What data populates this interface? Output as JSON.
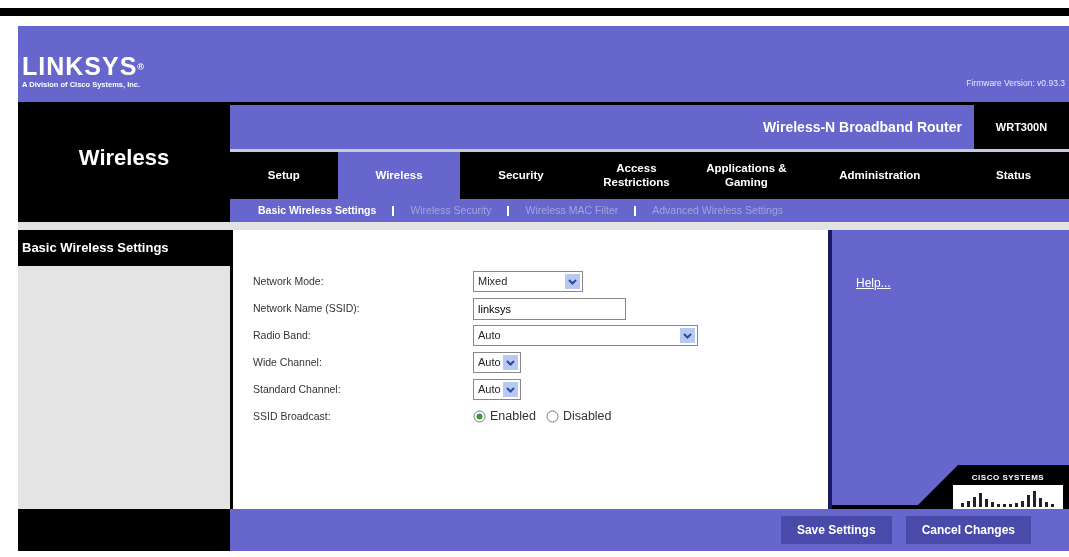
{
  "brand": {
    "logo": "LINKSYS$^{®}$",
    "tagline": "A Division of Cisco Systems, Inc.",
    "firmware": "Firmware Version: v0.93.3"
  },
  "section_title": "Wireless",
  "product": {
    "name": "Wireless-N Broadband Router",
    "model": "WRT300N"
  },
  "tabs": [
    {
      "label": "Setup",
      "selected": false
    },
    {
      "label": "Wireless",
      "selected": true
    },
    {
      "label": "Security",
      "selected": false
    },
    {
      "label": "Access Restrictions",
      "selected": false
    },
    {
      "label": "Applications & Gaming",
      "selected": false
    },
    {
      "label": "Administration",
      "selected": false
    },
    {
      "label": "Status",
      "selected": false
    }
  ],
  "subtabs": [
    {
      "label": "Basic Wireless Settings",
      "selected": true
    },
    {
      "label": "Wireless Security",
      "selected": false
    },
    {
      "label": "Wireless MAC Filter",
      "selected": false
    },
    {
      "label": "Advanced Wireless Settings",
      "selected": false
    }
  ],
  "page_title": "Basic Wireless Settings",
  "fields": [
    {
      "kind": "select",
      "label": "Network Mode:",
      "value": "Mixed"
    },
    {
      "kind": "text",
      "label": "Network Name (SSID):",
      "value": "linksys"
    },
    {
      "kind": "select",
      "label": "Radio Band:",
      "value": "Auto"
    },
    {
      "kind": "select",
      "label": "Wide Channel:",
      "value": "Auto"
    },
    {
      "kind": "select",
      "label": "Standard Channel:",
      "value": "Auto"
    },
    {
      "kind": "radio",
      "label": "SSID Broadcast:",
      "options": [
        {
          "label": "Enabled",
          "selected": true
        },
        {
          "label": "Disabled",
          "selected": false
        }
      ]
    }
  ],
  "help": "Help...",
  "buttons": [
    "Save Settings",
    "Cancel Changes"
  ],
  "footer_logo": "CISCO SYSTEMS"
}
